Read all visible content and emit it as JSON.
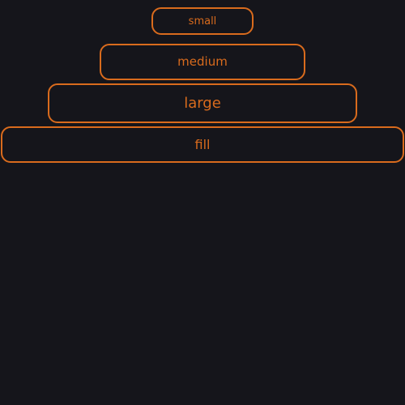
{
  "buttons": {
    "small": "small",
    "medium": "medium",
    "large": "large",
    "fill": "fill"
  },
  "colors": {
    "background": "#15151b",
    "accent": "#d96b1d"
  }
}
